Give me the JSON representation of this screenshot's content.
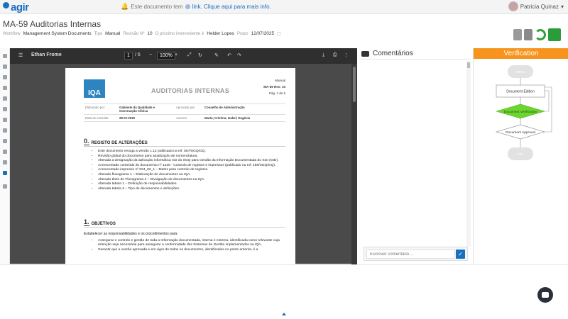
{
  "topbar": {
    "logo": "agir",
    "banner_text": "Este documento tem",
    "banner_link_text": "link. Clique aqui para mais info.",
    "user_name": "Patricia Quinaz"
  },
  "document": {
    "title": "MA-59 Auditorias Internas",
    "meta": [
      {
        "label": "Workflow",
        "value": "Management System Documents"
      },
      {
        "label": "Tipo",
        "value": "Manual"
      },
      {
        "label": "Revisão Nº",
        "value": "10"
      },
      {
        "label": "O próximo interveniente é",
        "value": "Helder Lopes"
      },
      {
        "label": "Prazo",
        "value": "12/07/2025"
      }
    ]
  },
  "viewer": {
    "user": "Ethan Frome",
    "page_current": "1",
    "page_total": "/ 6",
    "zoom": "100%"
  },
  "page": {
    "logo_text": "IQA",
    "doc_title": "AUDITORIAS INTERNAS",
    "right_type": "Manual",
    "right_ref": "MA-59 Rev: 10",
    "right_page": "Pág. 1 de 6",
    "table": {
      "r1": {
        "k1": "Elaborado por:",
        "v1": "Gabinete da Qualidade e Governação Clínica",
        "k2": "Aprovado por:",
        "v2": "Conselho de Administração"
      },
      "r2": {
        "k1": "Data de emissão:",
        "v1": "28-01-2025",
        "k2": "Autores:",
        "v2": "Marta; Cristina; Isabel; Eugénia"
      }
    },
    "section0": {
      "num": "0.",
      "title": "REGISTO DE ALTERAÇÕES",
      "items": [
        "Este documento revoga a versão 1.12 publicada na Inf. 567/SGQ/GQ.",
        "Revisão global do documento para atualização de nomenclatura.",
        "Alterada a designação da aplicação informática GD do SGQ para Gestão da Informação Documentada do SGI (GID).",
        "Acrescentado conteúdo do documento nº 1225 - Controlo de registos e impressos (publicado na Inf. 458/SGQ/GQ).",
        "Acrescentado impresso nº 024_02_1 – Matriz para controlo de registos.",
        "Alterado fluxograma 1 – Elaboração de documentos na IQA.",
        "Alterado título do Fluxograma 2 – Divulgação de documentos na IQA.",
        "Alterada tabela 1 – Definição de responsabilidades.",
        "Alterada tabela 2 – Tipo de documentos e definições."
      ]
    },
    "section1": {
      "num": "1.",
      "title": "OBJETIVOS",
      "intro": "Estabelecer as responsabilidades e os procedimentos para:",
      "items": [
        "Assegurar o controlo e gestão de toda a Informação documentada, interna e externa, identificada como relevante cuja retenção seja necessária para assegurar a conformidade dos Sistemas de Gestão implementados na IQA.",
        "Garantir que a versão aprovada e em vigor de todos os documentos, identificados no ponto anterior, é a"
      ]
    }
  },
  "comments": {
    "header": "Comentários",
    "placeholder": "Escrever comentário ..."
  },
  "verification": {
    "header": "Verification",
    "nodes": {
      "start": "INÍCIO",
      "edition": "Document Edition",
      "verification": "Document Verification",
      "approval": "Document Approval",
      "end": "FIM"
    },
    "colors": {
      "header": "#f7941d",
      "current_step": "#6dd62e"
    }
  }
}
